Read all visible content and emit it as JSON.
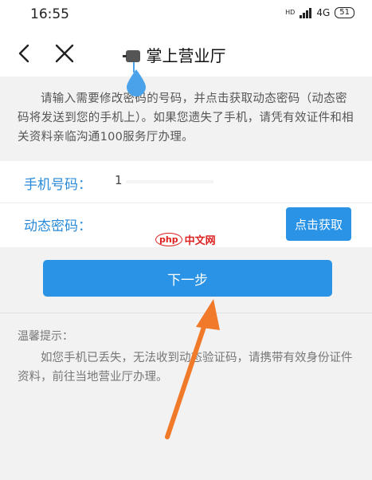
{
  "status_bar": {
    "time": "16:55",
    "network": "4G",
    "battery": "51"
  },
  "header": {
    "title": "掌上营业厅",
    "back_icon": "chevron-left-icon",
    "close_icon": "close-icon"
  },
  "notice": {
    "text": "请输入需要修改密码的号码，并点击获取动态密码（动态密码将发送到您的手机上）。如果您遗失了手机，请凭有效证件和相关资料亲临沟通100服务厅办理。"
  },
  "form": {
    "phone_label": "手机号码：",
    "phone_value": "1",
    "otp_label": "动态密码：",
    "otp_button": "点击获取"
  },
  "watermark": {
    "logo": "php",
    "text": "中文网"
  },
  "next_button": "下一步",
  "tips": {
    "title": "温馨提示：",
    "body": "如您手机已丢失，无法收到动态验证码，请携带有效身份证件资料，前往当地营业厅办理。"
  },
  "colors": {
    "accent": "#2a93e5",
    "label": "#2a8ad8",
    "arrow": "#f07a2a"
  }
}
